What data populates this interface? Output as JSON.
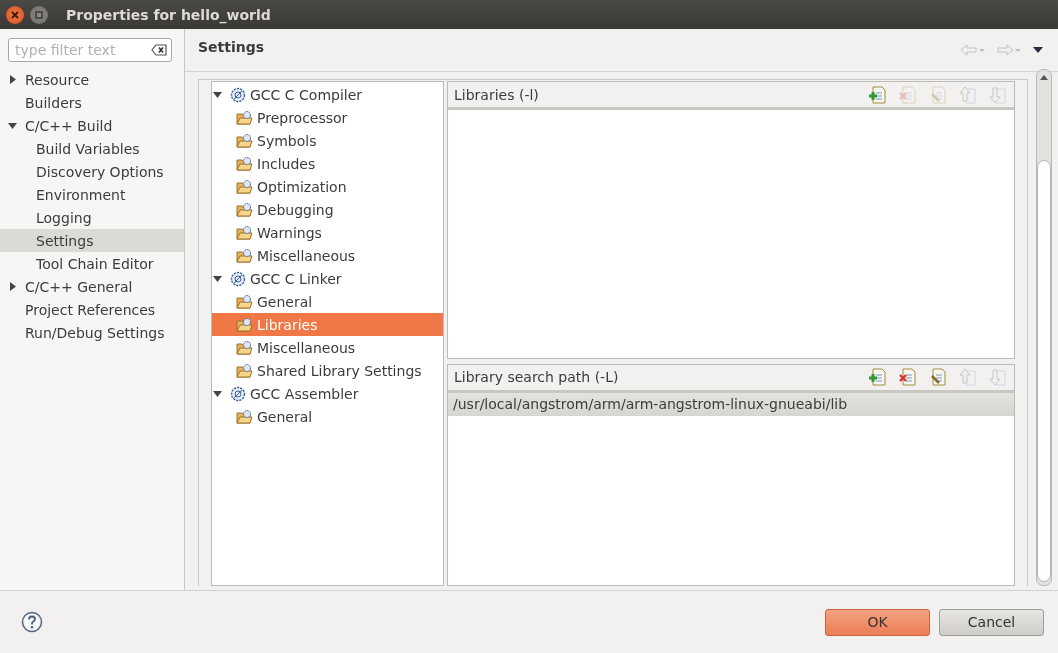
{
  "window": {
    "title": "Properties for hello_world"
  },
  "filter": {
    "placeholder": "type filter text"
  },
  "nav": [
    {
      "label": "Resource",
      "kind": "group",
      "expanded": false,
      "selected": false
    },
    {
      "label": "Builders",
      "kind": "page",
      "selected": false
    },
    {
      "label": "C/C++ Build",
      "kind": "group",
      "expanded": true,
      "selected": false,
      "children": [
        {
          "label": "Build Variables",
          "selected": false
        },
        {
          "label": "Discovery Options",
          "selected": false
        },
        {
          "label": "Environment",
          "selected": false
        },
        {
          "label": "Logging",
          "selected": false
        },
        {
          "label": "Settings",
          "selected": true
        },
        {
          "label": "Tool Chain Editor",
          "selected": false
        }
      ]
    },
    {
      "label": "C/C++ General",
      "kind": "group",
      "expanded": false,
      "selected": false
    },
    {
      "label": "Project References",
      "kind": "page",
      "selected": false
    },
    {
      "label": "Run/Debug Settings",
      "kind": "page",
      "selected": false
    }
  ],
  "page_title": "Settings",
  "tools": [
    {
      "label": "GCC C Compiler",
      "expanded": true,
      "selected": false,
      "children": [
        {
          "label": "Preprocessor",
          "selected": false
        },
        {
          "label": "Symbols",
          "selected": false
        },
        {
          "label": "Includes",
          "selected": false
        },
        {
          "label": "Optimization",
          "selected": false
        },
        {
          "label": "Debugging",
          "selected": false
        },
        {
          "label": "Warnings",
          "selected": false
        },
        {
          "label": "Miscellaneous",
          "selected": false
        }
      ]
    },
    {
      "label": "GCC C Linker",
      "expanded": true,
      "selected": false,
      "children": [
        {
          "label": "General",
          "selected": false
        },
        {
          "label": "Libraries",
          "selected": true
        },
        {
          "label": "Miscellaneous",
          "selected": false
        },
        {
          "label": "Shared Library Settings",
          "selected": false
        }
      ]
    },
    {
      "label": "GCC Assembler",
      "expanded": true,
      "selected": false,
      "children": [
        {
          "label": "General",
          "selected": false
        }
      ]
    }
  ],
  "panels": [
    {
      "title": "Libraries (-l)",
      "actions": [
        {
          "kind": "add",
          "disabled": false
        },
        {
          "kind": "delete",
          "disabled": true
        },
        {
          "kind": "edit",
          "disabled": true
        },
        {
          "kind": "up",
          "disabled": true
        },
        {
          "kind": "down",
          "disabled": true
        }
      ]
    },
    {
      "title": "Library search path (-L)",
      "actions": [
        {
          "kind": "add",
          "disabled": false
        },
        {
          "kind": "delete",
          "disabled": false
        },
        {
          "kind": "edit",
          "disabled": false
        },
        {
          "kind": "up",
          "disabled": true
        },
        {
          "kind": "down",
          "disabled": true
        }
      ],
      "items": [
        {
          "text": "/usr/local/angstrom/arm/arm-angstrom-linux-gnueabi/lib",
          "selected": true
        }
      ]
    }
  ],
  "buttons": [
    {
      "label": "OK",
      "kind": "default"
    },
    {
      "label": "Cancel",
      "kind": "normal"
    }
  ]
}
